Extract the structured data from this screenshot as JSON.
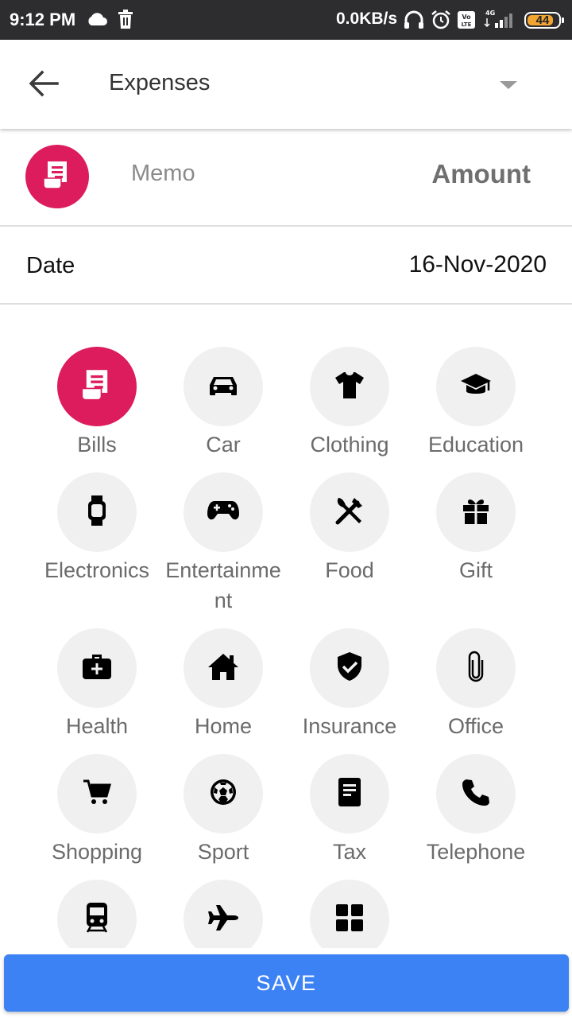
{
  "status_bar": {
    "time": "9:12 PM",
    "net_speed": "0.0KB/s",
    "battery": "44",
    "icons": [
      "cloud-icon",
      "trash-icon",
      "headset-icon",
      "alarm-icon",
      "volte-icon",
      "signal-4g-icon",
      "battery-icon"
    ]
  },
  "app_bar": {
    "title": "Expenses",
    "back_icon": "arrow-left-icon",
    "dropdown_icon": "caret-down-icon"
  },
  "entry": {
    "memo_placeholder": "Memo",
    "amount_placeholder": "Amount",
    "icon": "receipt-icon",
    "accent_color": "#dc1c5c"
  },
  "date": {
    "label": "Date",
    "value": "16-Nov-2020"
  },
  "categories": [
    {
      "label": "Bills",
      "icon": "receipt-icon",
      "selected": true
    },
    {
      "label": "Car",
      "icon": "car-icon"
    },
    {
      "label": "Clothing",
      "icon": "tshirt-icon"
    },
    {
      "label": "Education",
      "icon": "graduation-cap-icon"
    },
    {
      "label": "Electronics",
      "icon": "smartwatch-icon"
    },
    {
      "label": "Entertainment",
      "icon": "gamepad-icon"
    },
    {
      "label": "Food",
      "icon": "utensils-icon"
    },
    {
      "label": "Gift",
      "icon": "gift-icon"
    },
    {
      "label": "Health",
      "icon": "medkit-icon"
    },
    {
      "label": "Home",
      "icon": "house-icon"
    },
    {
      "label": "Insurance",
      "icon": "shield-check-icon"
    },
    {
      "label": "Office",
      "icon": "paperclip-icon"
    },
    {
      "label": "Shopping",
      "icon": "cart-icon"
    },
    {
      "label": "Sport",
      "icon": "soccer-ball-icon"
    },
    {
      "label": "Tax",
      "icon": "document-icon"
    },
    {
      "label": "Telephone",
      "icon": "phone-icon"
    },
    {
      "label": "",
      "icon": "train-icon"
    },
    {
      "label": "",
      "icon": "airplane-icon"
    },
    {
      "label": "",
      "icon": "grid-icon"
    }
  ],
  "save_label": "SAVE",
  "colors": {
    "status_bar": "#2d2d2f",
    "save_button": "#3d82f4",
    "selected_category": "#dc1c5c",
    "category_bg": "#f0f0f0"
  }
}
